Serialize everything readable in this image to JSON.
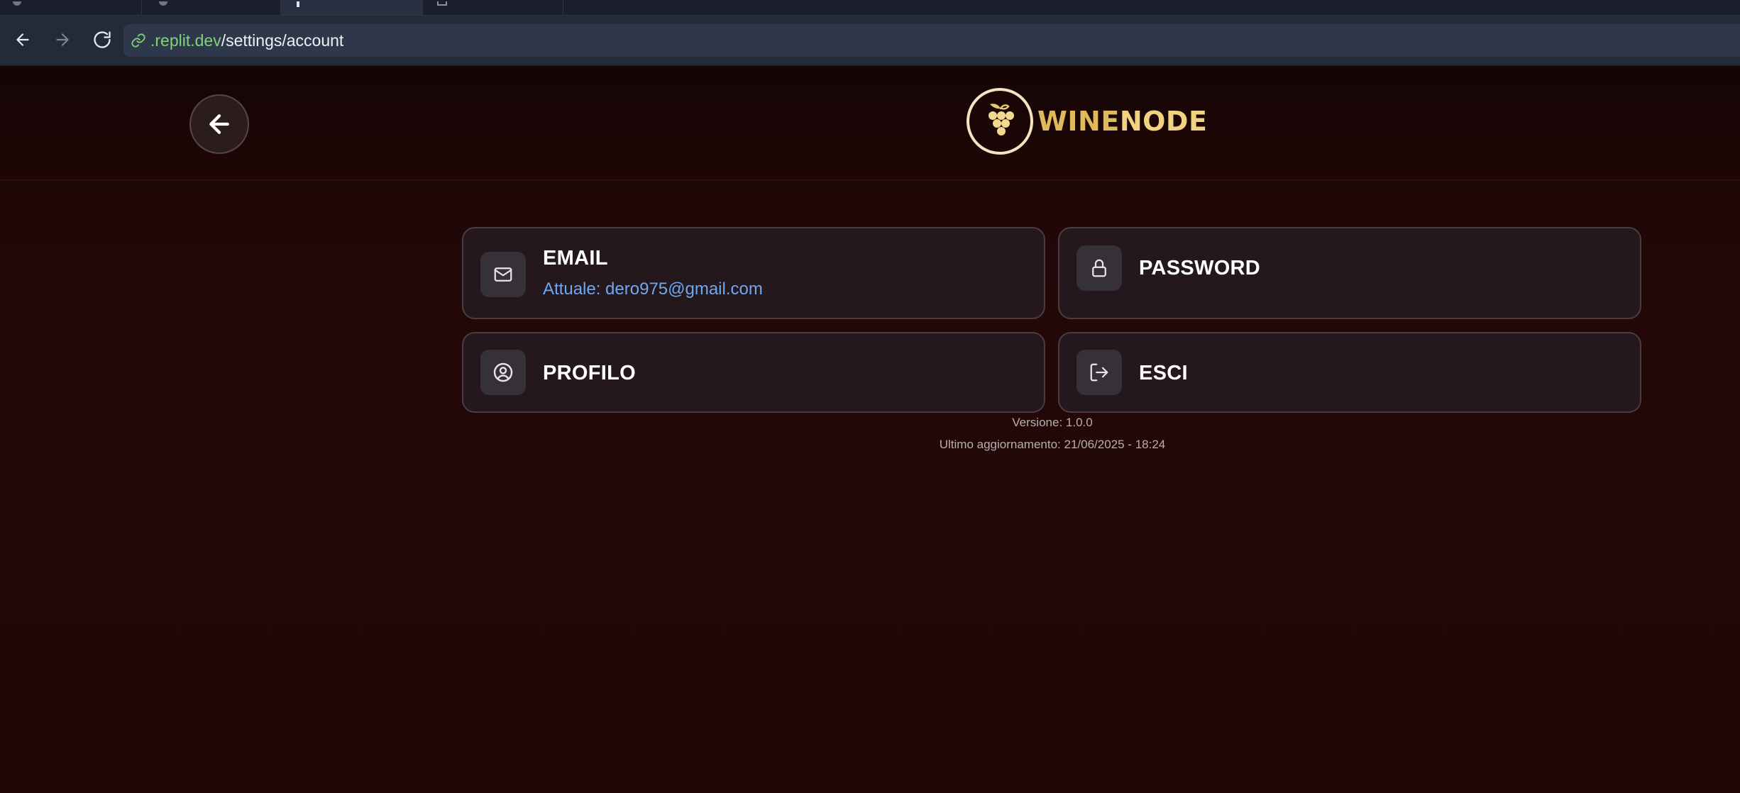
{
  "browser": {
    "url_domain": ".replit.dev",
    "url_path": "/settings/account"
  },
  "header": {
    "logo_word1": "WINE",
    "logo_word2": "NODE"
  },
  "cards": {
    "email": {
      "title": "EMAIL",
      "subtitle": "Attuale: dero975@gmail.com",
      "icon": "mail-icon"
    },
    "password": {
      "title": "PASSWORD",
      "icon": "lock-icon"
    },
    "profile": {
      "title": "PROFILO",
      "icon": "user-circle-icon"
    },
    "logout": {
      "title": "ESCI",
      "icon": "logout-icon"
    }
  },
  "footer": {
    "version": "Versione: 1.0.0",
    "last_update": "Ultimo aggiornamento: 21/06/2025 - 18:24"
  },
  "colors": {
    "background": "#210707",
    "card": "#24181d",
    "accent_link": "#6ea7f2",
    "logo_gold": "#e0b95b"
  }
}
